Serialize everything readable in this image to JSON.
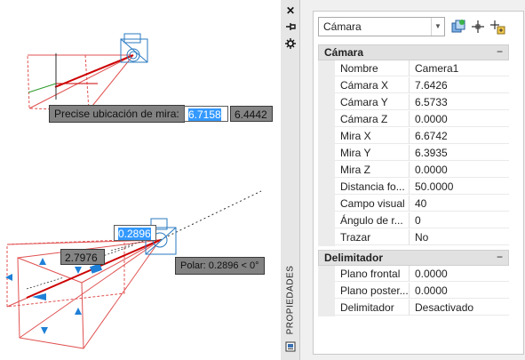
{
  "viewport_top": {
    "prompt_label": "Precise ubicación de mira:",
    "input_active": "6.7158",
    "input_second": "6.4442"
  },
  "viewport_bottom": {
    "input_distance": "0.2896",
    "input_length": "2.7976",
    "polar_tooltip": "Polar: 0.2896 < 0°"
  },
  "palette": {
    "title": "PROPIEDADES",
    "object_selector": "Cámara",
    "sections": [
      {
        "title": "Cámara",
        "collapse": "−",
        "rows": [
          {
            "label": "Nombre",
            "value": "Camera1"
          },
          {
            "label": "Cámara X",
            "value": "7.6426"
          },
          {
            "label": "Cámara Y",
            "value": "6.5733"
          },
          {
            "label": "Cámara Z",
            "value": "0.0000"
          },
          {
            "label": "Mira X",
            "value": "6.6742"
          },
          {
            "label": "Mira Y",
            "value": "6.3935"
          },
          {
            "label": "Mira Z",
            "value": "0.0000"
          },
          {
            "label": "Distancia fo...",
            "value": "50.0000"
          },
          {
            "label": "Campo visual",
            "value": "40"
          },
          {
            "label": "Ángulo de r...",
            "value": "0"
          },
          {
            "label": "Trazar",
            "value": "No"
          }
        ]
      },
      {
        "title": "Delimitador",
        "collapse": "−",
        "rows": [
          {
            "label": "Plano frontal",
            "value": "0.0000"
          },
          {
            "label": "Plano poster...",
            "value": "0.0000"
          },
          {
            "label": "Delimitador",
            "value": "Desactivado"
          }
        ]
      }
    ],
    "icons": [
      "close-icon",
      "auto-hide-icon",
      "palette-settings-icon",
      "quick-select-icon",
      "select-objects-icon",
      "pickadd-toggle-icon",
      "palette-properties-icon"
    ]
  }
}
